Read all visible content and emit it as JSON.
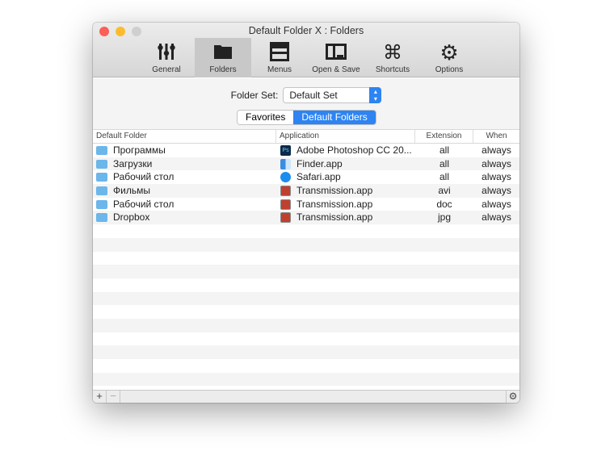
{
  "window": {
    "title": "Default Folder X : Folders"
  },
  "toolbar": [
    {
      "label": "General",
      "icon": "sliders-icon"
    },
    {
      "label": "Folders",
      "icon": "folder-icon"
    },
    {
      "label": "Menus",
      "icon": "menus-icon"
    },
    {
      "label": "Open & Save",
      "icon": "open-save-icon"
    },
    {
      "label": "Shortcuts",
      "icon": "command-icon"
    },
    {
      "label": "Options",
      "icon": "gear-icon"
    }
  ],
  "folder_set": {
    "label": "Folder Set:",
    "value": "Default Set"
  },
  "segments": {
    "favorites": "Favorites",
    "default_folders": "Default Folders"
  },
  "table": {
    "headers": [
      "Default Folder",
      "Application",
      "Extension",
      "When"
    ],
    "rows": [
      {
        "folder": "Программы",
        "app": "Adobe Photoshop CC 20...",
        "ext": "all",
        "when": "always",
        "icon": "photoshop"
      },
      {
        "folder": "Загрузки",
        "app": "Finder.app",
        "ext": "all",
        "when": "always",
        "icon": "finder"
      },
      {
        "folder": "Рабочий стол",
        "app": "Safari.app",
        "ext": "all",
        "when": "always",
        "icon": "safari"
      },
      {
        "folder": "Фильмы",
        "app": "Transmission.app",
        "ext": "avi",
        "when": "always",
        "icon": "transmission"
      },
      {
        "folder": "Рабочий стол",
        "app": "Transmission.app",
        "ext": "doc",
        "when": "always",
        "icon": "transmission"
      },
      {
        "folder": "Dropbox",
        "app": "Transmission.app",
        "ext": "jpg",
        "when": "always",
        "icon": "transmission"
      }
    ]
  },
  "bottom": {
    "add": "+",
    "remove": "−"
  },
  "colors": {
    "accent": "#2d84f2",
    "folder": "#6bb6ea"
  }
}
